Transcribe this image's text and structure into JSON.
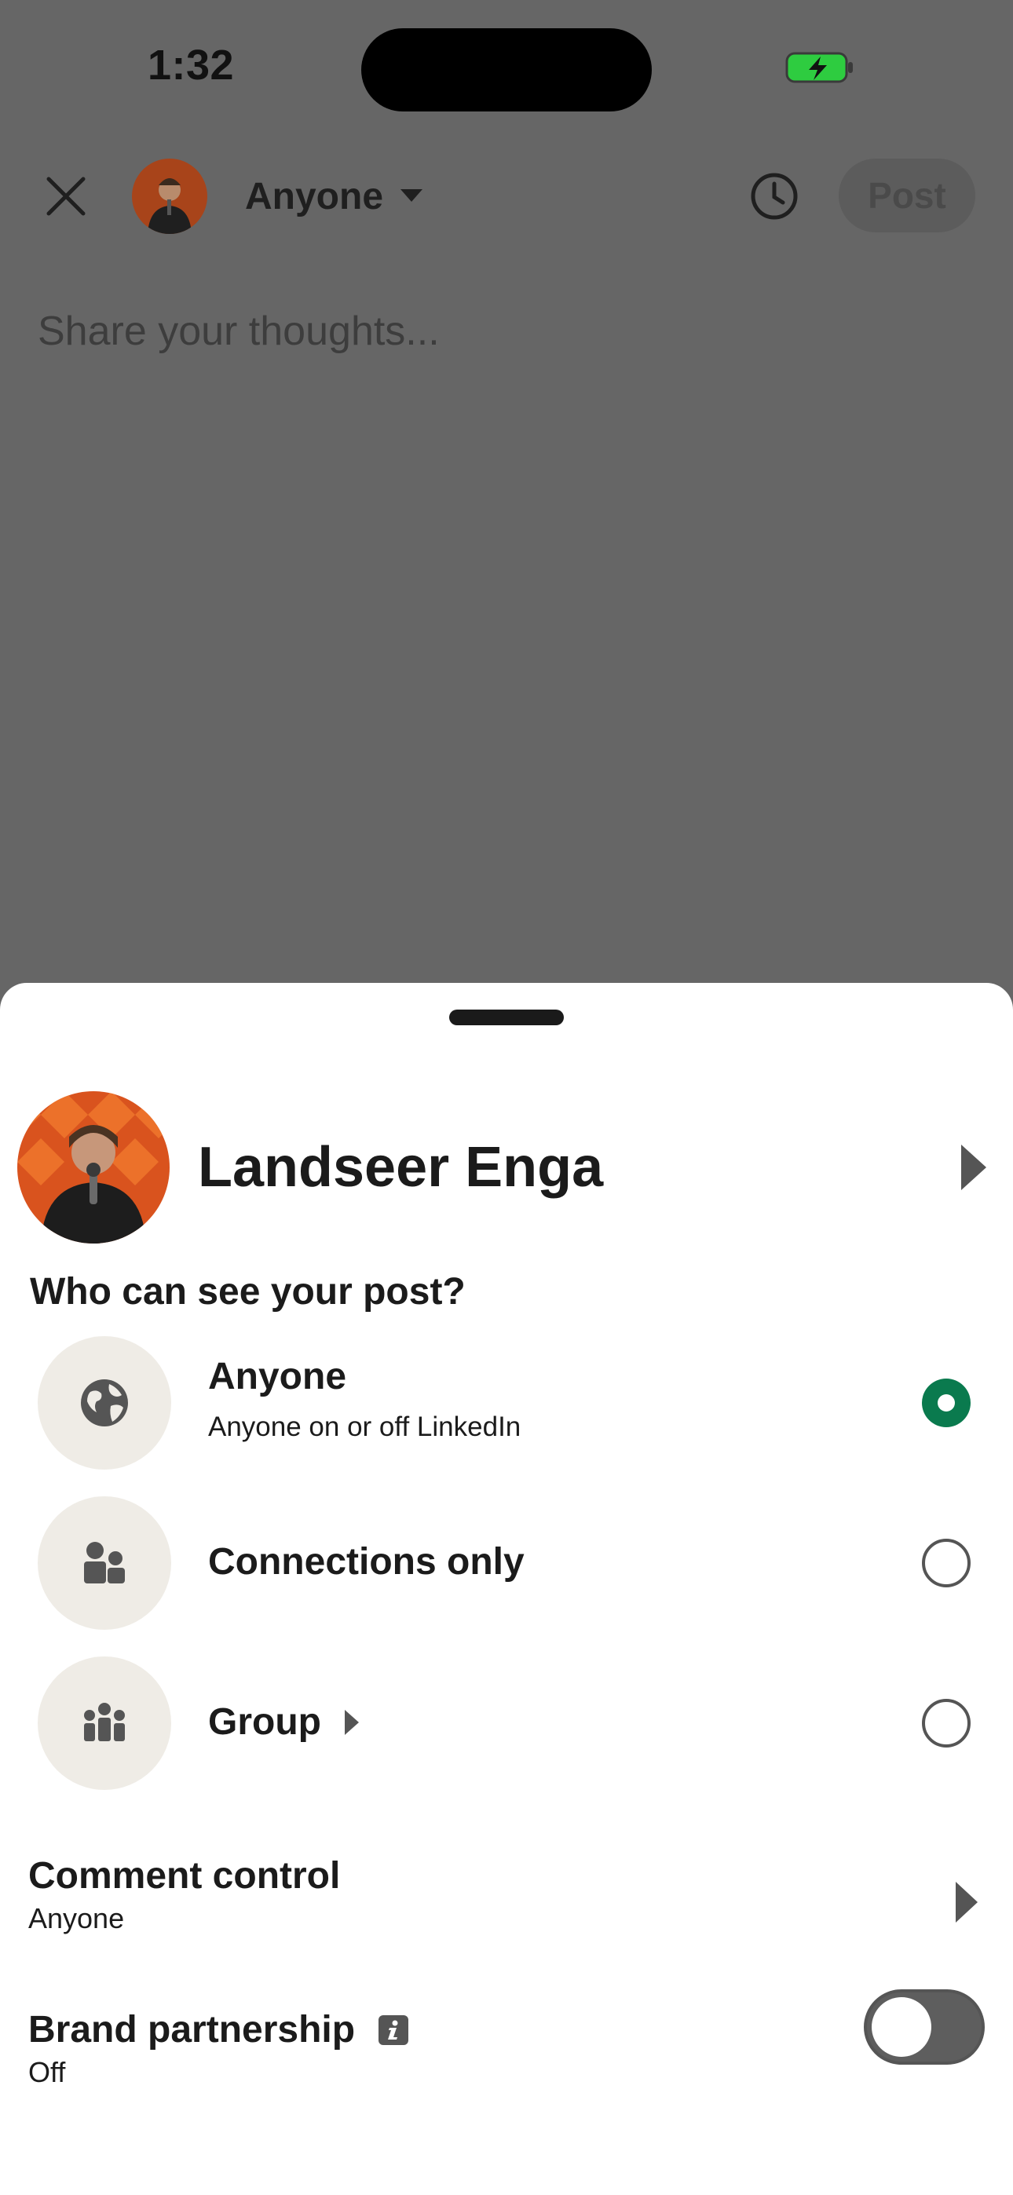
{
  "status_bar": {
    "time": "1:32",
    "battery_color": "#2ecc40"
  },
  "header": {
    "audience_label": "Anyone",
    "post_label": "Post"
  },
  "composer": {
    "placeholder": "Share your thoughts..."
  },
  "sheet": {
    "profile_name": "Landseer Enga",
    "question": "Who can see your post?",
    "options": [
      {
        "title": "Anyone",
        "subtitle": "Anyone on or off LinkedIn",
        "icon": "globe-icon",
        "selected": true
      },
      {
        "title": "Connections only",
        "icon": "people-icon",
        "selected": false
      },
      {
        "title": "Group",
        "icon": "group-icon",
        "selected": false
      }
    ],
    "comment_control": {
      "title": "Comment control",
      "value": "Anyone"
    },
    "brand_partnership": {
      "title": "Brand partnership",
      "value": "Off",
      "enabled": false
    },
    "selected_color": "#0a7a4e"
  }
}
